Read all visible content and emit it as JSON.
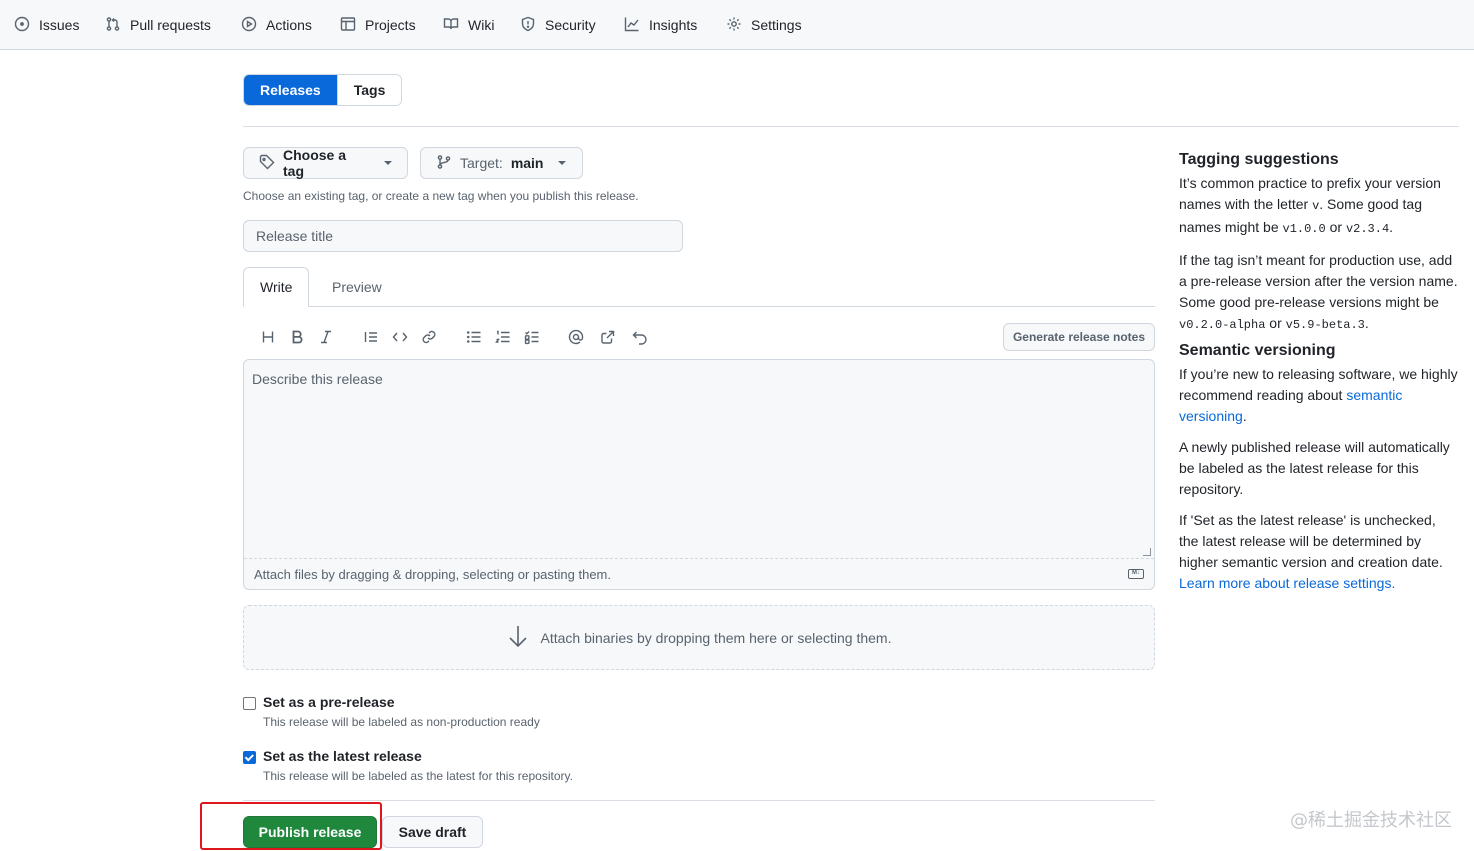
{
  "nav": {
    "items": [
      {
        "label": "Issues",
        "icon": "issue-opened-icon"
      },
      {
        "label": "Pull requests",
        "icon": "git-pull-request-icon"
      },
      {
        "label": "Actions",
        "icon": "play-icon"
      },
      {
        "label": "Projects",
        "icon": "table-icon"
      },
      {
        "label": "Wiki",
        "icon": "book-icon"
      },
      {
        "label": "Security",
        "icon": "shield-icon"
      },
      {
        "label": "Insights",
        "icon": "graph-icon"
      },
      {
        "label": "Settings",
        "icon": "gear-icon"
      }
    ]
  },
  "subnav": {
    "releases": "Releases",
    "tags": "Tags"
  },
  "form": {
    "choose_tag": "Choose a tag",
    "target_label": "Target:",
    "target_value": "main",
    "tag_help": "Choose an existing tag, or create a new tag when you publish this release.",
    "title_placeholder": "Release title",
    "tab_write": "Write",
    "tab_preview": "Preview",
    "generate_notes": "Generate release notes",
    "body_placeholder": "Describe this release",
    "attach_files": "Attach files by dragging & dropping, selecting or pasting them.",
    "md_badge": "M↓",
    "attach_binaries": "Attach binaries by dropping them here or selecting them.",
    "prerelease": {
      "label": "Set as a pre-release",
      "note": "This release will be labeled as non-production ready",
      "checked": false
    },
    "latest": {
      "label": "Set as the latest release",
      "note": "This release will be labeled as the latest for this repository.",
      "checked": true
    },
    "publish": "Publish release",
    "save_draft": "Save draft"
  },
  "sidebar": {
    "tagging_title": "Tagging suggestions",
    "tagging_p1_a": "It’s common practice to prefix your version names with the letter ",
    "tagging_p1_code1": "v",
    "tagging_p1_b": ". Some good tag names might be ",
    "tagging_p1_code2": "v1.0.0",
    "tagging_p1_c": " or ",
    "tagging_p1_code3": "v2.3.4",
    "tagging_p1_d": ".",
    "tagging_p2_a": "If the tag isn’t meant for production use, add a pre-release version after the version name. Some good pre-release versions might be ",
    "tagging_p2_code1": "v0.2.0-alpha",
    "tagging_p2_b": " or ",
    "tagging_p2_code2": "v5.9-beta.3",
    "tagging_p2_c": ".",
    "semver_title": "Semantic versioning",
    "semver_p1_a": "If you’re new to releasing software, we highly recommend reading about ",
    "semver_p1_link": "semantic versioning",
    "semver_p1_b": ".",
    "semver_p2": "A newly published release will automatically be labeled as the latest release for this repository.",
    "semver_p3": "If 'Set as the latest release' is unchecked, the latest release will be determined by higher semantic version and creation date.",
    "learn_more": "Learn more about release settings."
  },
  "watermark": "@稀土掘金技术社区",
  "colors": {
    "primary": "#0969da",
    "publish": "#1f883d",
    "highlight": "#e0161e"
  }
}
